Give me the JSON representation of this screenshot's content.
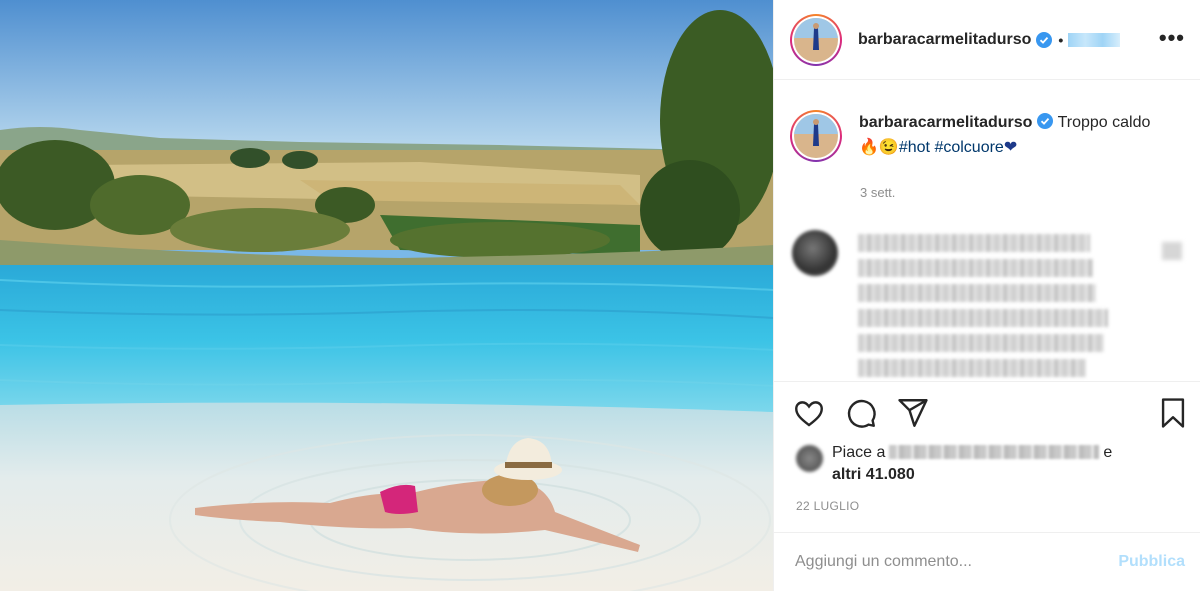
{
  "post": {
    "username": "barbaracarmelitadurso",
    "dot": "•",
    "more_label": "•••",
    "caption_prefix": "Troppo caldo",
    "caption_emoji": "🔥😉",
    "hashtag1": "#hot",
    "hashtag2": "#colcuore",
    "caption_suffix_emoji": "❤",
    "caption_time": "3 sett.",
    "likes_prefix": "Piace a",
    "likes_mid": "e",
    "likes_count": "altri 41.080",
    "date": "22 LUGLIO"
  },
  "comment_box": {
    "placeholder": "Aggiungi un commento...",
    "publish_label": "Pubblica"
  },
  "icons": {
    "like": "heart-icon",
    "comment": "comment-icon",
    "share": "paper-plane-icon",
    "save": "bookmark-icon",
    "verified": "verified-badge-icon"
  },
  "colors": {
    "verified_blue": "#3897f0",
    "hashtag": "#00376b",
    "publish_disabled": "#b2dffc",
    "secondary_text": "#8e8e8e"
  }
}
